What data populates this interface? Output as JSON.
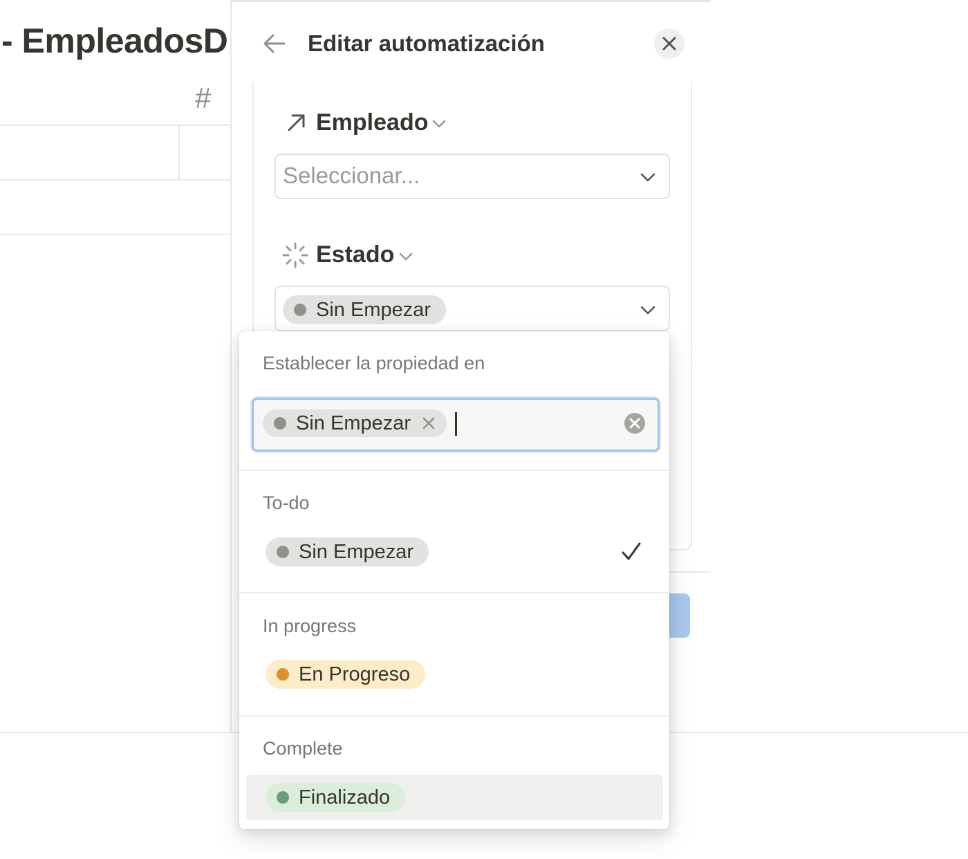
{
  "background": {
    "page_title": "- EmpleadosD",
    "column_icon": "#"
  },
  "panel": {
    "back_icon": "arrow-left-icon",
    "title": "Editar automatización",
    "close_icon": "close-icon",
    "properties": [
      {
        "name": "Empleado",
        "icon": "arrow-up-right-icon",
        "placeholder": "Seleccionar..."
      },
      {
        "name": "Estado",
        "icon": "status-spinner-icon",
        "value": "Sin Empezar"
      }
    ]
  },
  "dropdown": {
    "header": "Establecer la propiedad en",
    "selected_tag": "Sin Empezar",
    "groups": [
      {
        "name": "To-do",
        "options": [
          {
            "label": "Sin Empezar",
            "color": "#9b9a97",
            "bg": "#e3e2e0",
            "selected": true
          }
        ]
      },
      {
        "name": "In progress",
        "options": [
          {
            "label": "En Progreso",
            "color": "#d9922a",
            "bg": "#fdecc8",
            "selected": false
          }
        ]
      },
      {
        "name": "Complete",
        "options": [
          {
            "label": "Finalizado",
            "color": "#6c9b7d",
            "bg": "#dbeddb",
            "selected": false,
            "highlighted": true
          }
        ]
      }
    ]
  },
  "colors": {
    "accent": "#2383e2",
    "focus_ring": "#9fc3ec",
    "button_blue": "#a8c8ee"
  }
}
